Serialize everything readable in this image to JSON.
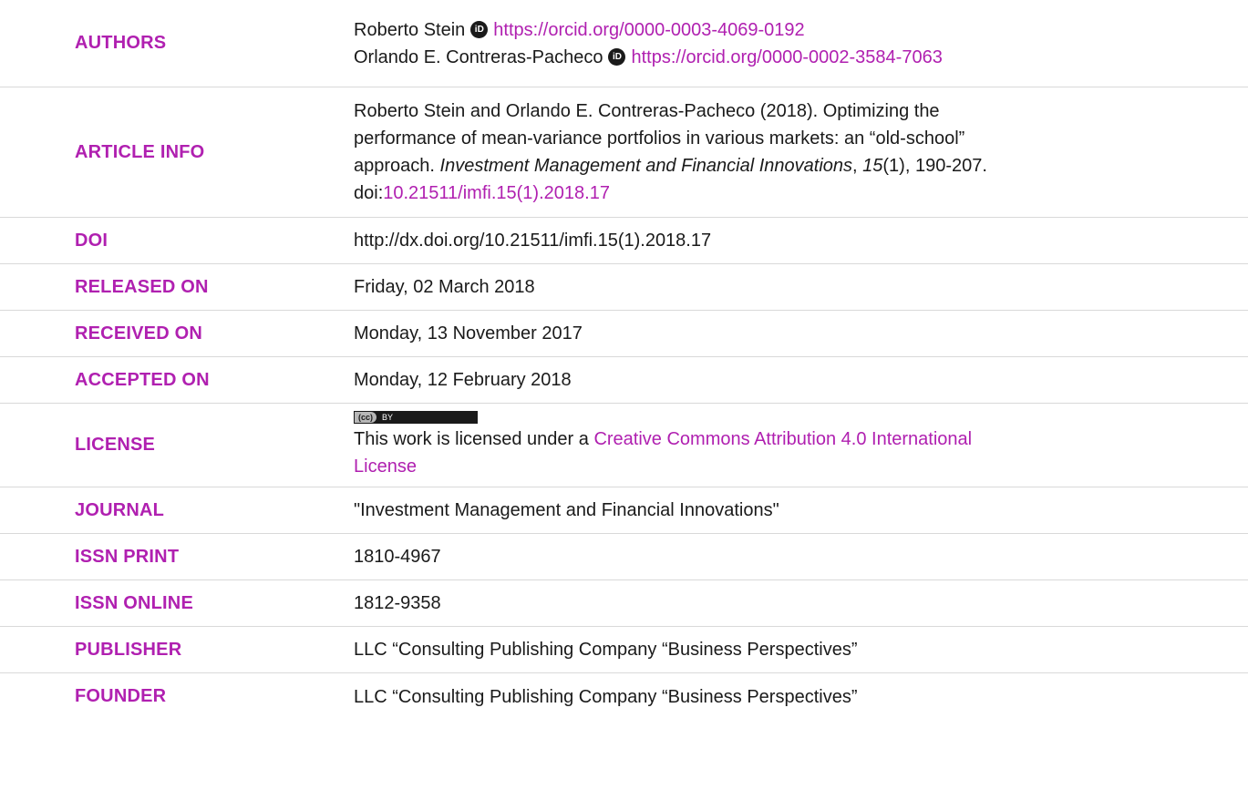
{
  "authors": {
    "label": "AUTHORS",
    "list": [
      {
        "name": "Roberto Stein",
        "orcid": "https://orcid.org/0000-0003-4069-0192"
      },
      {
        "name": "Orlando E. Contreras-Pacheco",
        "orcid": "https://orcid.org/0000-0002-3584-7063"
      }
    ]
  },
  "article_info": {
    "label": "ARTICLE INFO",
    "line1": "Roberto Stein and Orlando E. Contreras-Pacheco (2018). Optimizing the",
    "line2": "performance of mean-variance portfolios in various markets: an “old-school”",
    "line3_pre": "approach. ",
    "journal_italic": "Investment Management and Financial Innovations",
    "comma": ", ",
    "volume_italic": "15",
    "issue_pages": "(1), 190-207.",
    "doi_prefix": "doi:",
    "doi_link": "10.21511/imfi.15(1).2018.17"
  },
  "doi": {
    "label": "DOI",
    "value": "http://dx.doi.org/10.21511/imfi.15(1).2018.17"
  },
  "released": {
    "label": "RELEASED ON",
    "value": "Friday, 02 March 2018"
  },
  "received": {
    "label": "RECEIVED ON",
    "value": "Monday, 13 November 2017"
  },
  "accepted": {
    "label": "ACCEPTED ON",
    "value": "Monday, 12 February 2018"
  },
  "license": {
    "label": "LICENSE",
    "badge_left": "(cc)",
    "badge_right": "BY",
    "text": "This work is licensed under a ",
    "link_line1": "Creative Commons Attribution 4.0 International",
    "link_line2": "License"
  },
  "journal": {
    "label": "JOURNAL",
    "value": "\"Investment Management and Financial Innovations\""
  },
  "issn_print": {
    "label": "ISSN PRINT",
    "value": "1810-4967"
  },
  "issn_online": {
    "label": "ISSN ONLINE",
    "value": "1812-9358"
  },
  "publisher": {
    "label": "PUBLISHER",
    "value": "LLC “Consulting Publishing Company “Business Perspectives”"
  },
  "founder": {
    "label": "FOUNDER",
    "value": "LLC “Consulting Publishing Company “Business Perspectives”"
  },
  "icons": {
    "orcid": "orcid-icon",
    "cc_by": "cc-by-badge-icon"
  },
  "colors": {
    "label": "#b020b0",
    "link": "#b020b0",
    "divider": "#d9d9d9"
  }
}
